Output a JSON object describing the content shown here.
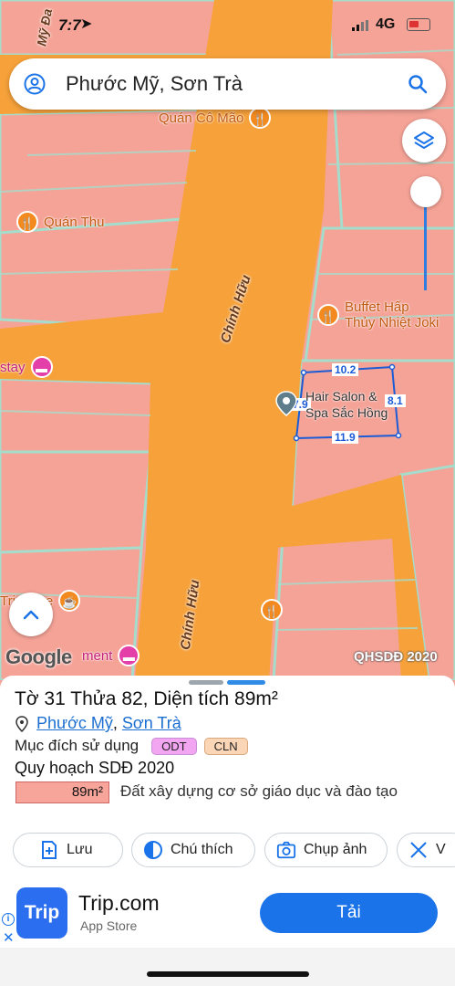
{
  "status_bar": {
    "time": "7:7",
    "network": "4G"
  },
  "search": {
    "query": "Phước Mỹ, Sơn Trà"
  },
  "map": {
    "pois": [
      {
        "name": "Quán Cô Mão",
        "icon": "fork-knife-icon"
      },
      {
        "name": "Quán Thu",
        "icon": "fork-knife-icon"
      },
      {
        "name": "Buffet Hấp\nThủy Nhiệt Joki",
        "icon": "fork-knife-icon"
      },
      {
        "name": "stay",
        "icon": "hotel-icon"
      },
      {
        "name": "Tri    ffee",
        "icon": "coffee-icon"
      },
      {
        "name": "ment",
        "icon": "hotel-icon"
      }
    ],
    "streets": [
      "Chính Hữu",
      "Chính Hữu"
    ],
    "parcel_dims": {
      "top": "10.2",
      "right": "8.1",
      "bottom": "11.9",
      "left": "7.9"
    },
    "salon_label": "Hair Salon &\nSpa Sắc Hồng",
    "attribution": "Google",
    "layer_name": "QHSDĐ 2020",
    "colors": {
      "residential": "#f5a397",
      "road": "#f6a13a",
      "border": "#9ed8c8"
    }
  },
  "sheet": {
    "title": "Tờ 31 Thửa 82, Diện tích 89m²",
    "ward": "Phước Mỹ",
    "district": "Sơn Trà",
    "purpose_label": "Mục đích sử dụng",
    "purpose_codes": [
      "ODT",
      "CLN"
    ],
    "plan_label": "Quy hoạch SDĐ 2020",
    "plan_area": "89m²",
    "plan_desc": "Đất xây dựng cơ sở giáo dục và đào tạo",
    "actions": [
      {
        "label": "Lưu",
        "icon": "save-plus-icon"
      },
      {
        "label": "Chú thích",
        "icon": "contrast-icon"
      },
      {
        "label": "Chụp ảnh",
        "icon": "camera-icon"
      },
      {
        "label": "V",
        "icon": "tools-icon"
      }
    ]
  },
  "ad": {
    "brand_logo": "Trip",
    "name": "Trip.com",
    "store": "App Store",
    "cta": "Tải"
  }
}
